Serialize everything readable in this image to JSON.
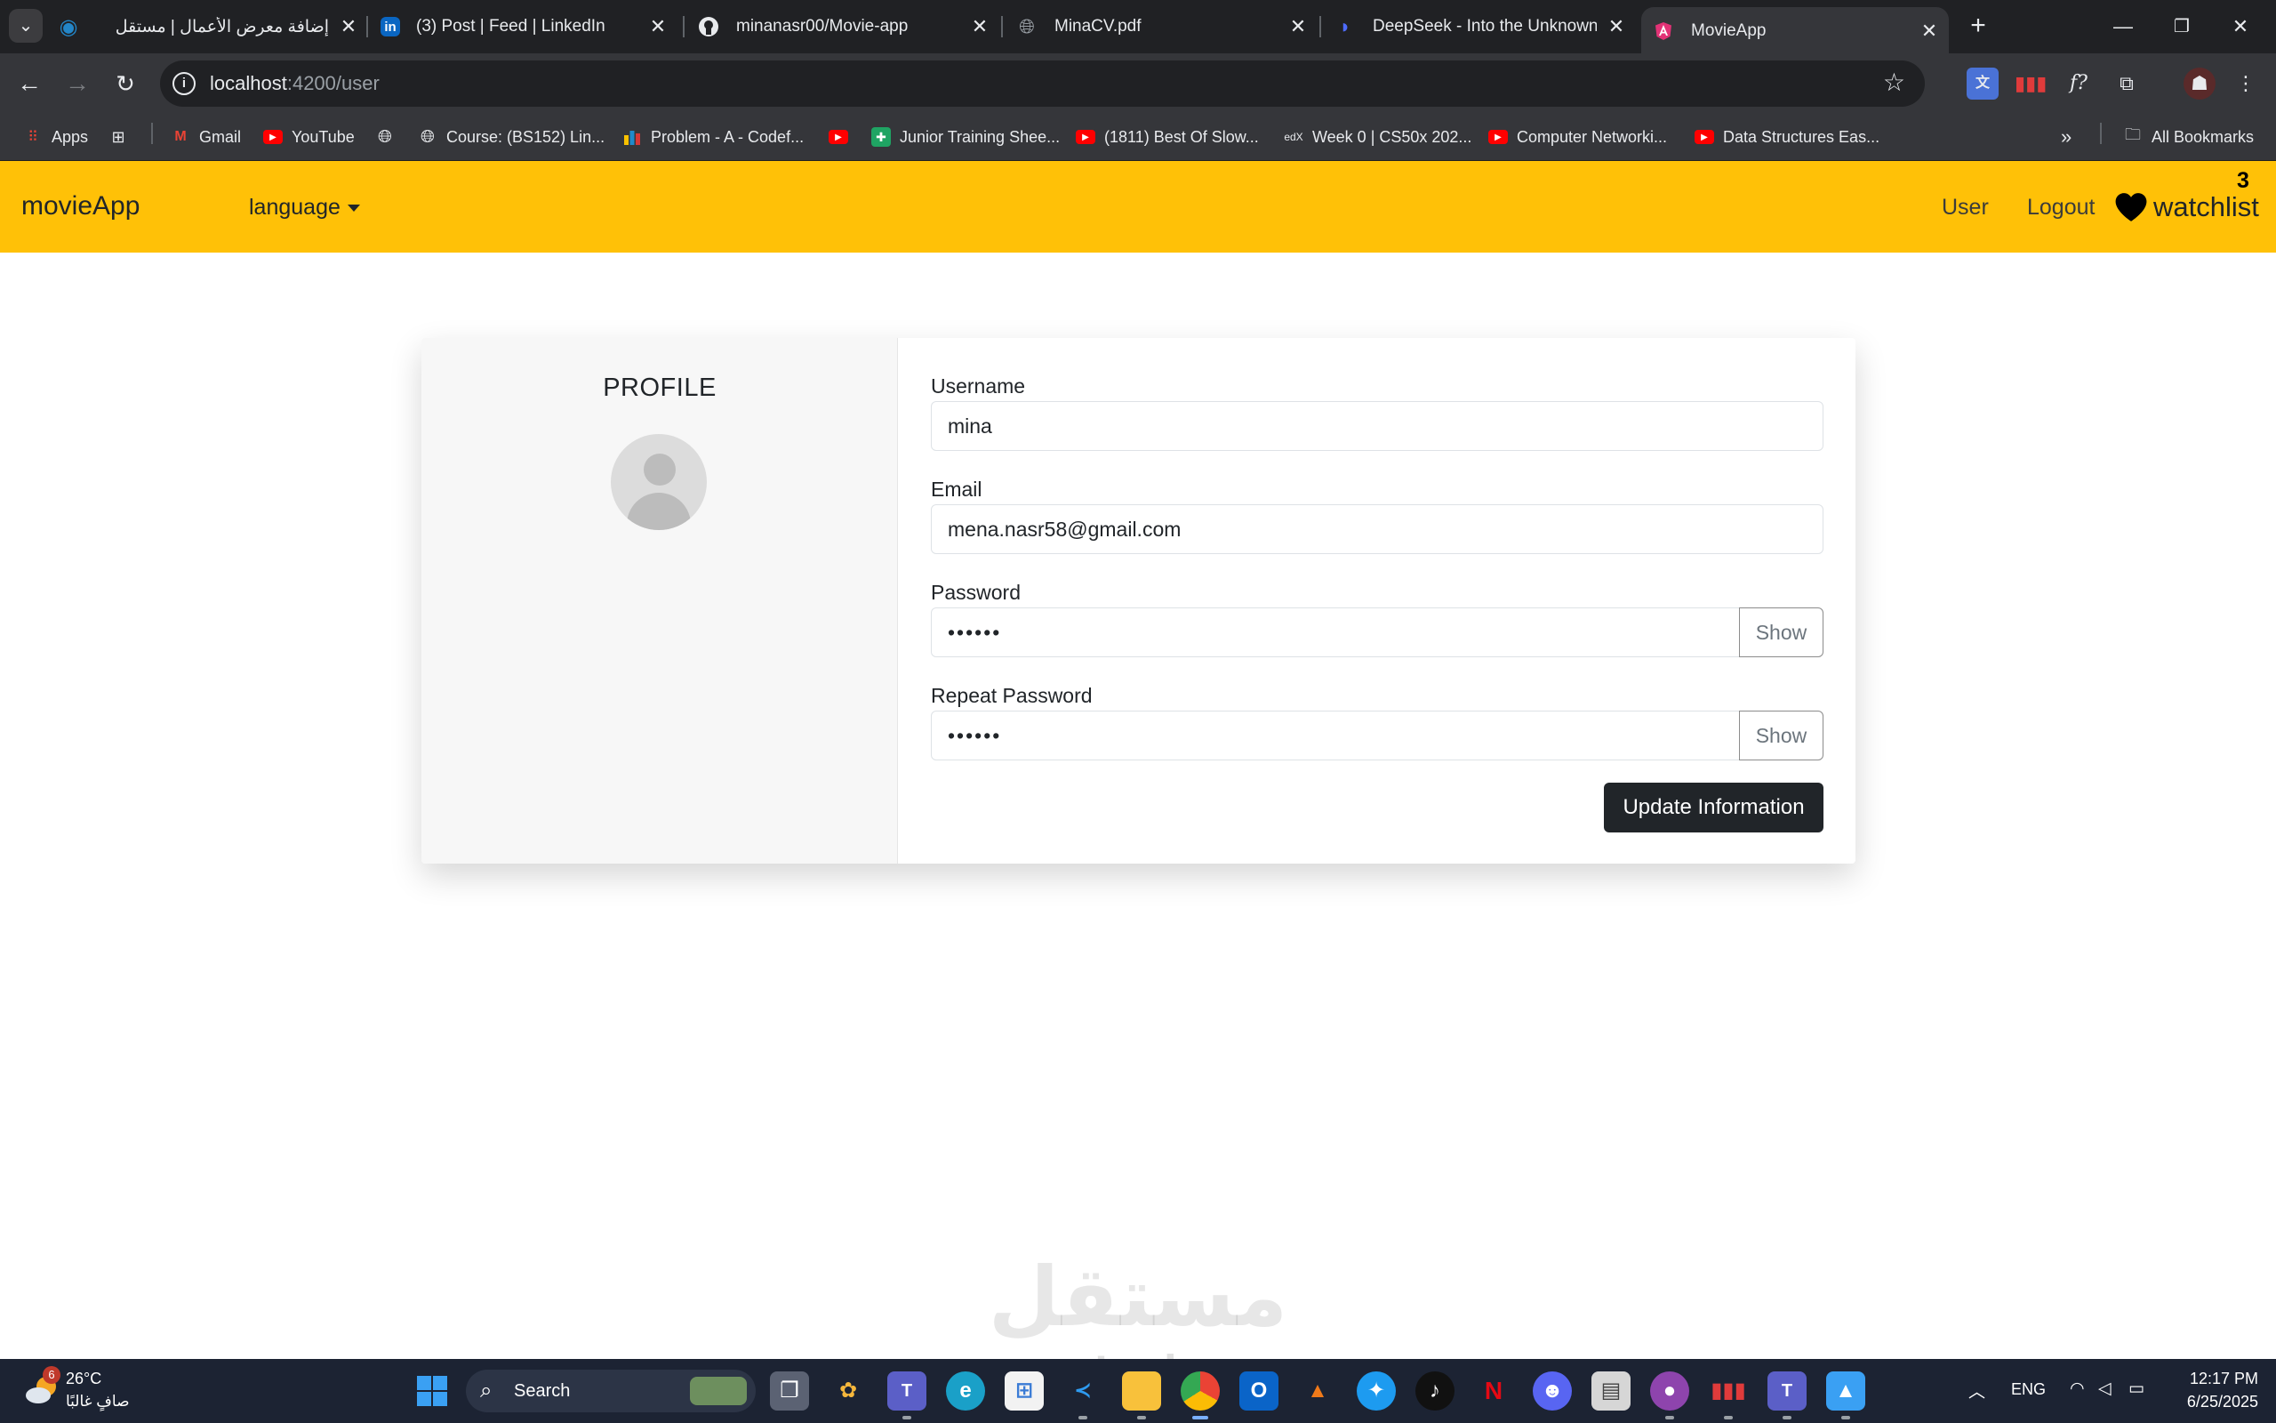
{
  "browser": {
    "tabs": [
      {
        "title": "إضافة معرض الأعمال | مستقل",
        "icon": "mostaql-icon"
      },
      {
        "title": "(3) Post | Feed | LinkedIn",
        "icon": "linkedin-icon"
      },
      {
        "title": "minanasr00/Movie-app",
        "icon": "github-icon"
      },
      {
        "title": "MinaCV.pdf",
        "icon": "globe-icon"
      },
      {
        "title": "DeepSeek - Into the Unknown",
        "icon": "deepseek-icon"
      },
      {
        "title": "MovieApp",
        "icon": "angular-icon"
      }
    ],
    "active_tab": 5,
    "url_host": "localhost",
    "url_path": ":4200/user",
    "bookmarks": [
      {
        "label": "Apps",
        "icon": "apps-grid-icon"
      },
      {
        "label": "",
        "icon": "dashboard-icon"
      },
      {
        "label": "Gmail",
        "icon": "gmail-icon"
      },
      {
        "label": "YouTube",
        "icon": "youtube-icon"
      },
      {
        "label": "",
        "icon": "globe-icon"
      },
      {
        "label": "Course: (BS152) Lin...",
        "icon": "globe-icon"
      },
      {
        "label": "Problem - A - Codef...",
        "icon": "codeforces-icon"
      },
      {
        "label": "",
        "icon": "youtube-icon"
      },
      {
        "label": "Junior Training Shee...",
        "icon": "sheets-icon"
      },
      {
        "label": "(1811) Best Of Slow...",
        "icon": "youtube-icon"
      },
      {
        "label": "Week 0 | CS50x 202...",
        "icon": "edx-icon"
      },
      {
        "label": "Computer Networki...",
        "icon": "youtube-icon"
      },
      {
        "label": "Data Structures Eas...",
        "icon": "youtube-icon"
      }
    ],
    "all_bookmarks_label": "All Bookmarks"
  },
  "navbar": {
    "brand": "movieApp",
    "language_label": "language",
    "user_label": "User",
    "logout_label": "Logout",
    "watchlist_label": "watchlist",
    "watchlist_count": "3",
    "background_color": "#ffc107"
  },
  "profile": {
    "title": "PROFILE",
    "fields": {
      "username": {
        "label": "Username",
        "value": "mina"
      },
      "email": {
        "label": "Email",
        "value": "mena.nasr58@gmail.com"
      },
      "password": {
        "label": "Password",
        "value": "••••••",
        "toggle_label": "Show"
      },
      "repeat_password": {
        "label": "Repeat Password",
        "value": "••••••",
        "toggle_label": "Show"
      }
    },
    "submit_label": "Update Information"
  },
  "watermark": {
    "arabic": "مستقل",
    "latin": "mostaql.com"
  },
  "taskbar": {
    "weather_temp": "26°C",
    "weather_desc": "صافٍ غالبًا",
    "weather_badge": "6",
    "search_placeholder": "Search",
    "language": "ENG",
    "time": "12:17 PM",
    "date": "6/25/2025"
  }
}
